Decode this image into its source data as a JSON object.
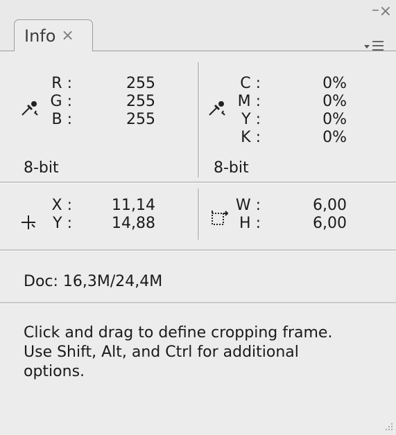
{
  "window": {
    "minimize_glyph": "–",
    "close_glyph": "×"
  },
  "tab": {
    "label": "Info",
    "close_glyph": "×"
  },
  "rgb": {
    "labels": [
      "R :",
      "G :",
      "B :"
    ],
    "values": [
      "255",
      "255",
      "255"
    ],
    "bit_depth": "8-bit"
  },
  "cmyk": {
    "labels": [
      "C :",
      "M :",
      "Y :",
      "K :"
    ],
    "values": [
      "0%",
      "0%",
      "0%",
      "0%"
    ],
    "bit_depth": "8-bit"
  },
  "position": {
    "x_label": "X :",
    "y_label": "Y :",
    "x_value": "11,14",
    "y_value": "14,88"
  },
  "size": {
    "w_label": "W :",
    "h_label": "H :",
    "w_value": "6,00",
    "h_value": "6,00"
  },
  "doc": {
    "text": "Doc: 16,3M/24,4M"
  },
  "hint": {
    "line1": "Click and drag to define cropping frame.",
    "line2": "Use Shift, Alt, and Ctrl for additional",
    "line3": "options."
  },
  "icons": [
    "eyedropper-icon",
    "crosshair-icon",
    "selection-size-icon",
    "panel-menu-icon",
    "resize-grip-icon"
  ]
}
